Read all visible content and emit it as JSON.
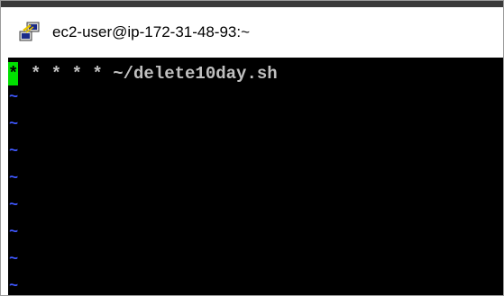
{
  "window": {
    "title": "ec2-user@ip-172-31-48-93:~",
    "icon": "putty-icon"
  },
  "terminal": {
    "cursor_char": "*",
    "command_rest": "* * * * ~/delete10day.sh",
    "tilde_lines": [
      "~",
      "~",
      "~",
      "~",
      "~",
      "~",
      "~",
      "~"
    ],
    "colors": {
      "background": "#000000",
      "text": "#c0c0c0",
      "cursor": "#00e000",
      "tilde": "#3f58ff"
    }
  }
}
